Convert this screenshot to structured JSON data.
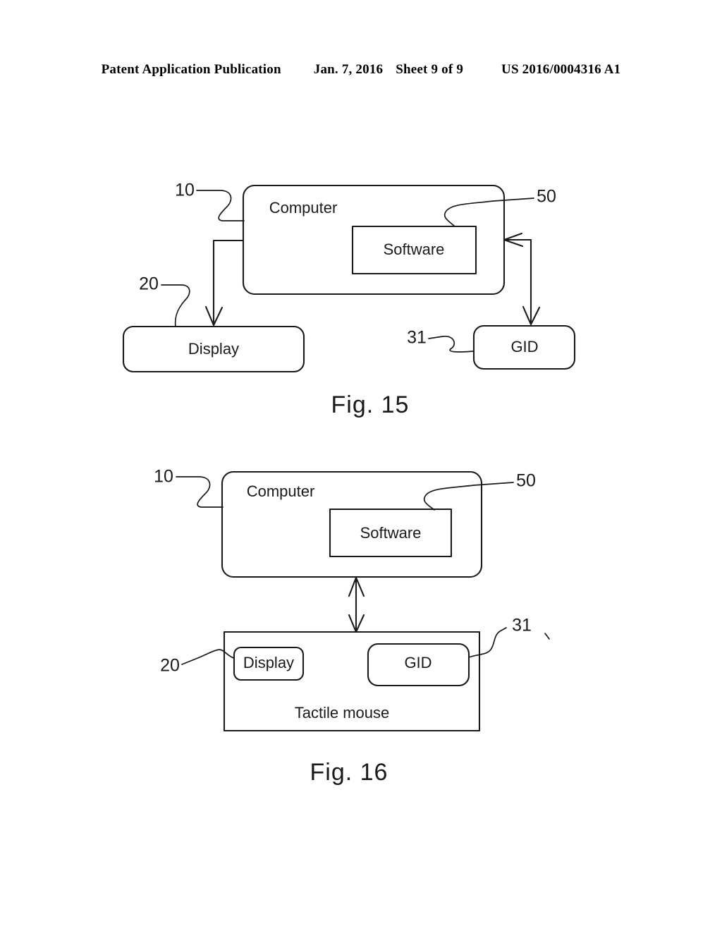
{
  "header": {
    "publication": "Patent Application Publication",
    "date": "Jan. 7, 2016",
    "sheet": "Sheet 9 of 9",
    "patent_number": "US 2016/0004316 A1"
  },
  "figures": [
    {
      "caption": "Fig. 15",
      "boxes": {
        "computer": "Computer",
        "software": "Software",
        "display": "Display",
        "gid": "GID"
      },
      "numerals": {
        "computer_ref": "10",
        "software_ref": "50",
        "display_ref": "20",
        "gid_ref": "31"
      }
    },
    {
      "caption": "Fig. 16",
      "boxes": {
        "computer": "Computer",
        "software": "Software",
        "display": "Display",
        "gid": "GID",
        "tactile_mouse": "Tactile mouse"
      },
      "numerals": {
        "computer_ref": "10",
        "software_ref": "50",
        "display_ref": "20",
        "gid_ref": "31"
      }
    }
  ],
  "colors": {
    "ink": "#1a1a1a",
    "paper": "#ffffff"
  }
}
